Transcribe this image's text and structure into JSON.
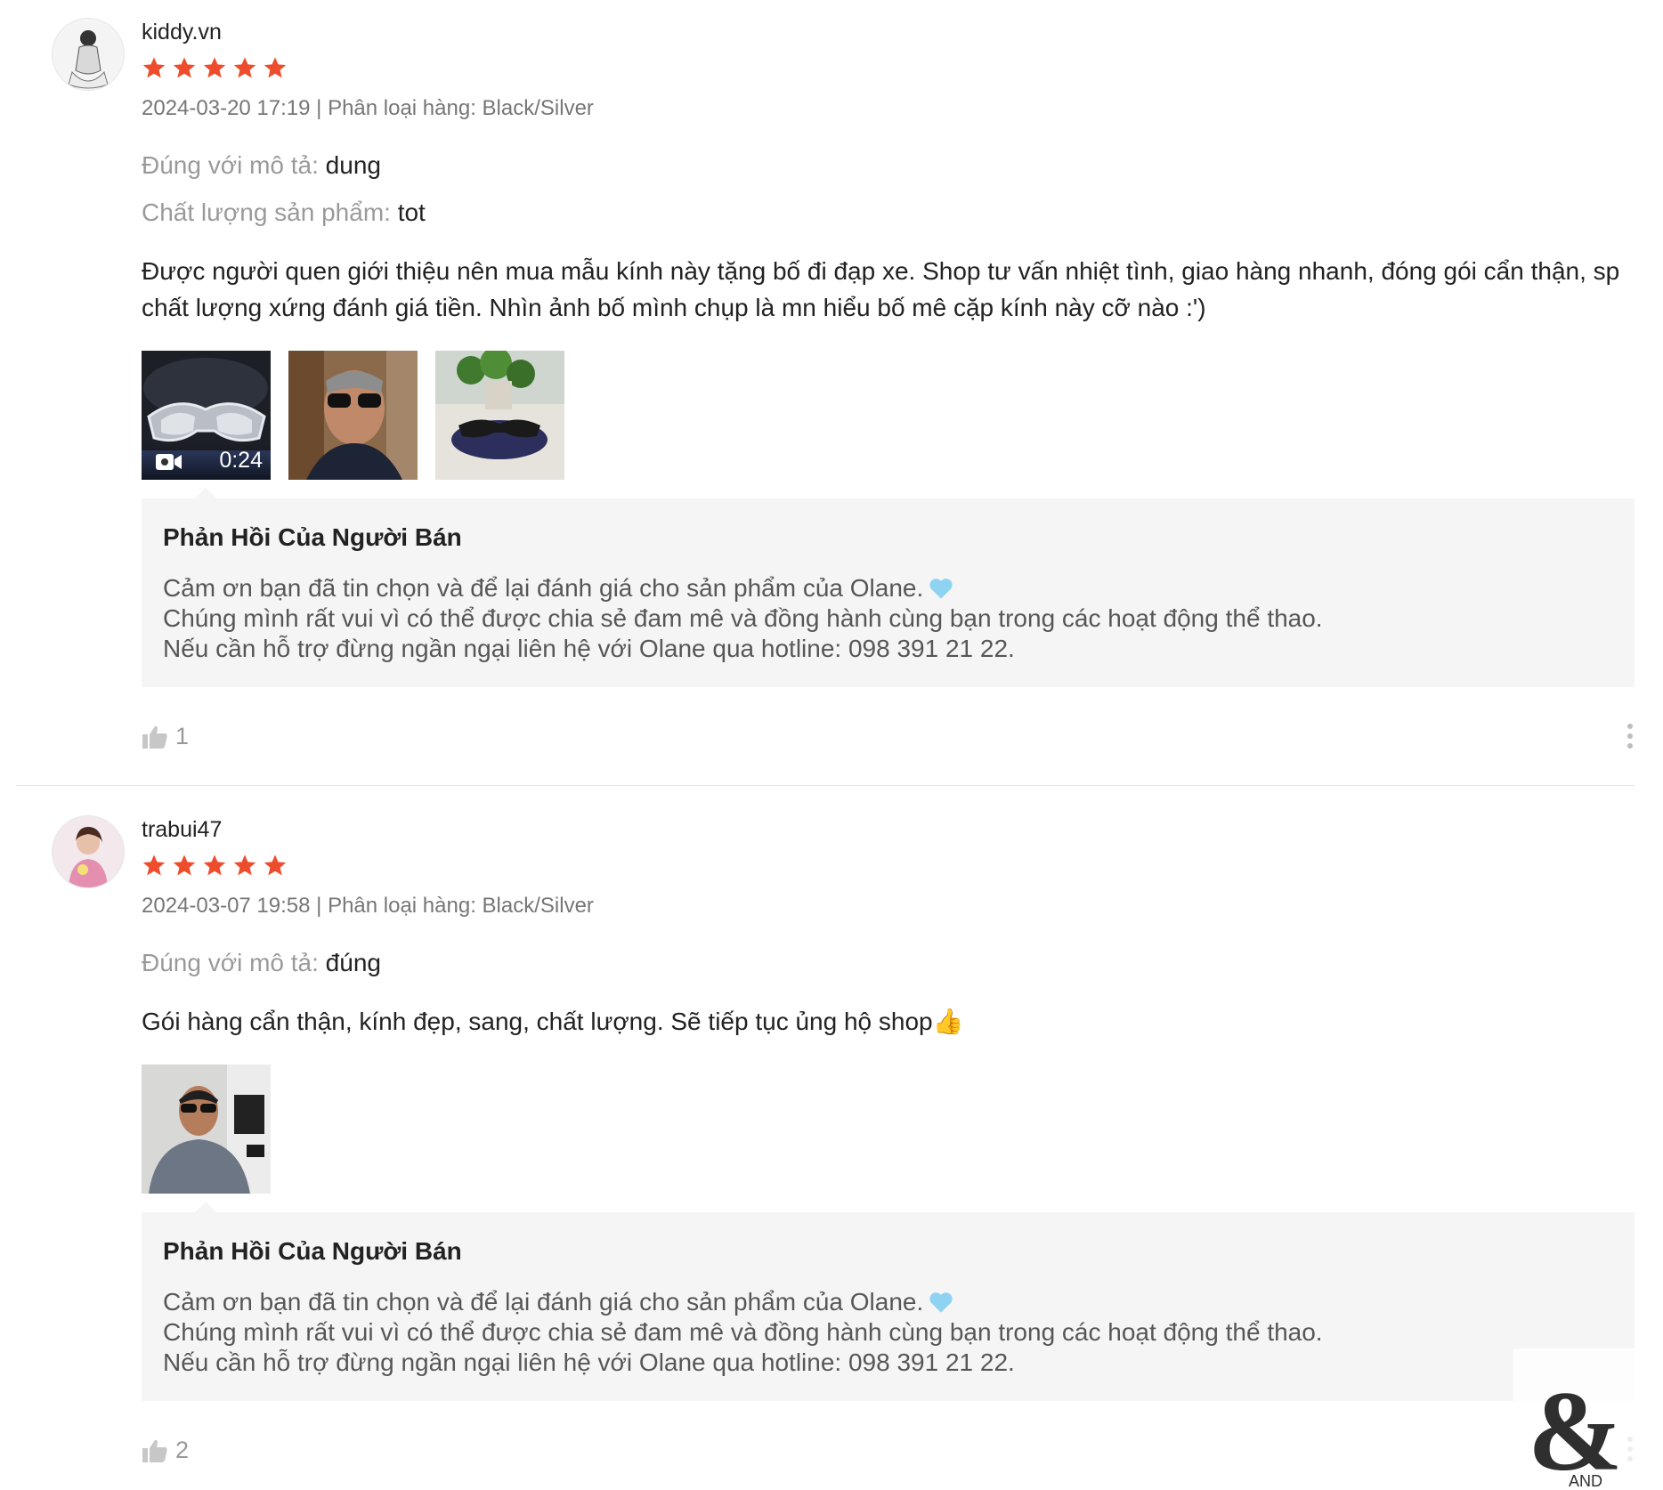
{
  "reviews": [
    {
      "username": "kiddy.vn",
      "rating": 5,
      "meta": "2024-03-20 17:19 | Phân loại hàng: Black/Silver",
      "attributes": [
        {
          "label": "Đúng với mô tả:",
          "value": "dung"
        },
        {
          "label": "Chất lượng sản phẩm:",
          "value": "tot"
        }
      ],
      "comment": "Được người quen giới thiệu nên mua mẫu kính này tặng bố đi đạp xe. Shop tư vấn nhiệt tình, giao hàng nhanh, đóng gói cẩn thận, sp chất lượng xứng đánh giá tiền. Nhìn ảnh bố mình chụp là mn hiểu bố mê cặp kính này cỡ nào :')",
      "media": [
        {
          "type": "video",
          "duration": "0:24"
        },
        {
          "type": "image"
        },
        {
          "type": "image"
        }
      ],
      "seller_reply": {
        "title": "Phản Hồi Của Người Bán",
        "lines": [
          "Cảm ơn bạn đã tin chọn và để lại đánh giá cho sản phẩm của Olane.",
          "Chúng mình rất vui vì có thể được chia sẻ đam mê và đồng hành cùng bạn trong các hoạt động thể thao.",
          "Nếu cần hỗ trợ đừng ngần ngại liên hệ với Olane qua hotline: 098 391 21 22."
        ]
      },
      "likes": "1"
    },
    {
      "username": "trabui47",
      "rating": 5,
      "meta": "2024-03-07 19:58 | Phân loại hàng: Black/Silver",
      "attributes": [
        {
          "label": "Đúng với mô tả:",
          "value": "đúng"
        }
      ],
      "comment": "Gói hàng cẩn thận, kính đẹp, sang, chất lượng. Sẽ tiếp tục ủng hộ shop👍",
      "media": [
        {
          "type": "image"
        }
      ],
      "seller_reply": {
        "title": "Phản Hồi Của Người Bán",
        "lines": [
          "Cảm ơn bạn đã tin chọn và để lại đánh giá cho sản phẩm của Olane.",
          "Chúng mình rất vui vì có thể được chia sẻ đam mê và đồng hành cùng bạn trong các hoạt động thể thao.",
          "Nếu cần hỗ trợ đừng ngần ngại liên hệ với Olane qua hotline: 098 391 21 22."
        ]
      },
      "likes": "2"
    }
  ],
  "icons": {
    "star": "star-icon",
    "like": "thumbs-up-icon",
    "more": "more-vertical-icon",
    "video": "video-camera-icon",
    "heart": "light-blue-heart-icon"
  },
  "colors": {
    "star": "#ee4d2d",
    "reply_bg": "#f5f5f5",
    "heart": "#8fd3f2"
  },
  "watermark": "AND"
}
